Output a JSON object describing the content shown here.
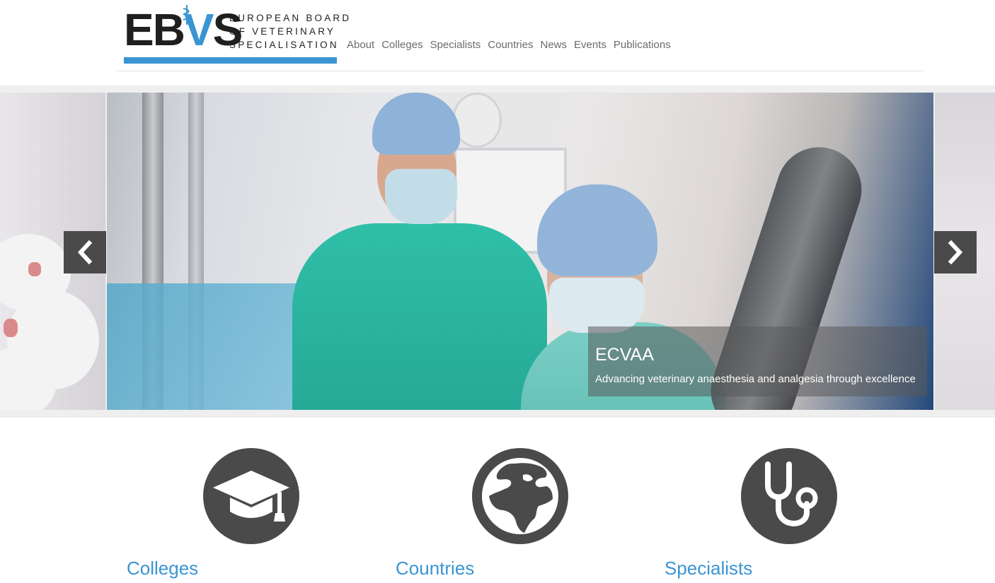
{
  "logo": {
    "letters": [
      "E",
      "B",
      "V",
      "S"
    ],
    "words": [
      "EUROPEAN BOARD",
      "OF VETERINARY",
      "SPECIALISATION"
    ],
    "brand_blue": "#3a95d2"
  },
  "nav": {
    "items": [
      "About",
      "Colleges",
      "Specialists",
      "Countries",
      "News",
      "Events",
      "Publications"
    ]
  },
  "carousel": {
    "caption_title": "ECVAA",
    "caption_text": "Advancing veterinary anaesthesia and analgesia through excellence",
    "prev_icon": "chevron-left-icon",
    "next_icon": "chevron-right-icon"
  },
  "features": [
    {
      "title": "Colleges",
      "icon": "graduation-cap-icon"
    },
    {
      "title": "Countries",
      "icon": "globe-icon"
    },
    {
      "title": "Specialists",
      "icon": "stethoscope-icon"
    }
  ],
  "colors": {
    "icon_circle": "#4a4a4a",
    "link": "#3a95d2",
    "nav_text": "#6b6b6b"
  }
}
